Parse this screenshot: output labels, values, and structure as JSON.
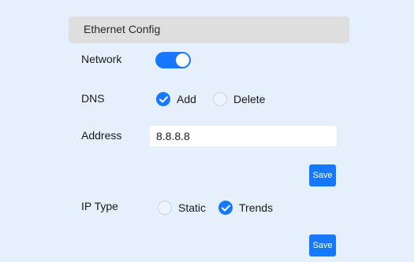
{
  "panel": {
    "title": "Ethernet Config"
  },
  "network": {
    "label": "Network",
    "enabled": true
  },
  "dns": {
    "label": "DNS",
    "options": [
      {
        "label": "Add",
        "checked": true
      },
      {
        "label": "Delete",
        "checked": false
      }
    ]
  },
  "address": {
    "label": "Address",
    "value": "8.8.8.8",
    "save_label": "Save"
  },
  "ip_type": {
    "label": "IP Type",
    "options": [
      {
        "label": "Static",
        "checked": false
      },
      {
        "label": "Trends",
        "checked": true
      }
    ],
    "save_label": "Save"
  },
  "colors": {
    "accent": "#1677ff",
    "panel_bg": "#e6f0fd",
    "header_bg": "#dedede"
  },
  "icons": {
    "checked": "check-icon"
  }
}
